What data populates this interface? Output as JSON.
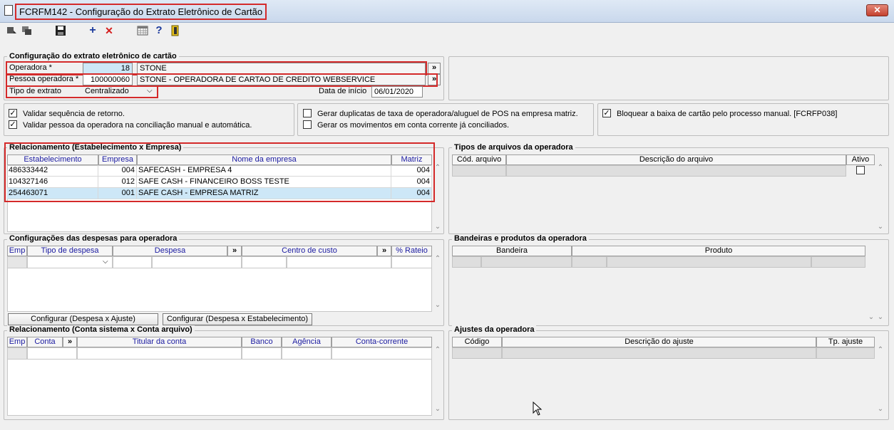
{
  "window": {
    "title": "FCRFM142 - Configuração do Extrato Eletrônico de Cartão",
    "close_label": "✕"
  },
  "toolbar": {
    "icons": [
      "first-record-icon",
      "copy-record-icon",
      "save-icon",
      "add-icon",
      "delete-icon",
      "calendar-grid-icon",
      "help-icon",
      "exit-door-icon"
    ],
    "add_glyph": "+",
    "delete_glyph": "✕",
    "help_glyph": "?"
  },
  "config": {
    "title": "Configuração do extrato eletrônico de cartão",
    "operadora_label": "Operadora *",
    "operadora_code": "18",
    "operadora_name": "STONE",
    "pessoa_label": "Pessoa operadora *",
    "pessoa_code": "100000060",
    "pessoa_name": "STONE - OPERADORA DE CARTAO DE CREDITO WEBSERVICE",
    "tipo_label": "Tipo de extrato",
    "tipo_value": "Centralizado",
    "data_label": "Data de início",
    "data_value": "06/01/2020",
    "lookup_glyph": "»"
  },
  "checks": {
    "validar_sequencia": "Validar sequência de retorno.",
    "validar_pessoa": "Validar pessoa da operadora na conciliação manual e automática.",
    "gerar_duplicatas": "Gerar duplicatas de taxa de operadora/aluguel de POS na empresa matriz.",
    "gerar_movimentos": "Gerar os movimentos em conta corrente já conciliados.",
    "bloquear_baixa": "Bloquear a baixa de cartão pelo processo manual. [FCRFP038]",
    "check_glyph": "✓"
  },
  "relacionamento": {
    "title": "Relacionamento (Estabelecimento x Empresa)",
    "headers": [
      "Estabelecimento",
      "Empresa",
      "Nome da empresa",
      "Matriz"
    ],
    "rows": [
      {
        "estab": "486333442",
        "empresa": "004",
        "nome": "SAFECASH -  EMPRESA 4",
        "matriz": "004"
      },
      {
        "estab": "104327146",
        "empresa": "012",
        "nome": "SAFE CASH - FINANCEIRO BOSS TESTE",
        "matriz": "004"
      },
      {
        "estab": "254463071",
        "empresa": "001",
        "nome": "SAFE CASH - EMPRESA MATRIZ",
        "matriz": "004"
      }
    ]
  },
  "tipos_arquivos": {
    "title": "Tipos de arquivos da operadora",
    "headers": [
      "Cód. arquivo",
      "Descrição do arquivo",
      "Ativo"
    ]
  },
  "despesas": {
    "title": "Configurações das despesas para operadora",
    "headers": [
      "Emp",
      "Tipo de despesa",
      "Despesa",
      "»",
      "Centro de custo",
      "»",
      "% Rateio"
    ],
    "btn_ajuste": "Configurar (Despesa x Ajuste)",
    "btn_estab": "Configurar (Despesa x Estabelecimento)"
  },
  "bandeiras": {
    "title": "Bandeiras e produtos da operadora",
    "headers": [
      "Bandeira",
      "Produto"
    ]
  },
  "conta": {
    "title": "Relacionamento (Conta sistema x Conta arquivo)",
    "headers": [
      "Emp",
      "Conta",
      "»",
      "Titular da conta",
      "Banco",
      "Agência",
      "Conta-corrente"
    ]
  },
  "ajustes": {
    "title": "Ajustes da operadora",
    "headers": [
      "Código",
      "Descrição do ajuste",
      "Tp. ajuste"
    ]
  }
}
